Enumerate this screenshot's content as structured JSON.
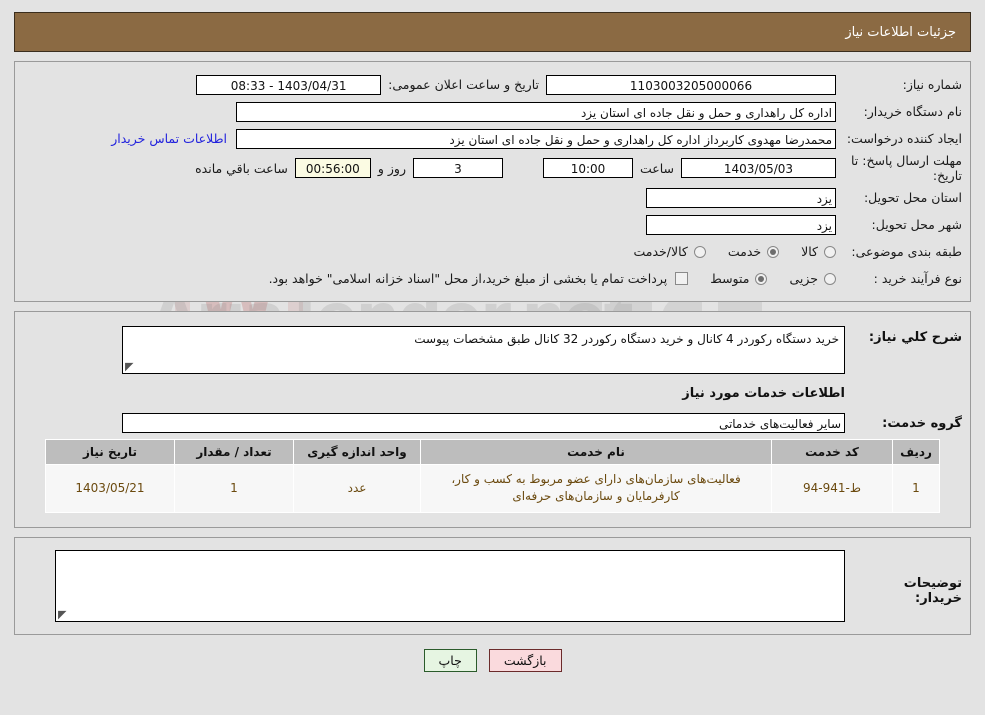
{
  "header": {
    "title": "جزئیات اطلاعات نیاز",
    "bg_color": "#8b6a43"
  },
  "watermark": {
    "text": "AriaTender.net"
  },
  "form": {
    "need_number": {
      "label": "شماره نیاز:",
      "value": "1103003205000066"
    },
    "announce_datetime": {
      "label": "تاریخ و ساعت اعلان عمومی:",
      "value": "1403/04/31 - 08:33"
    },
    "buyer_org": {
      "label": "نام دستگاه خریدار:",
      "value": "اداره کل راهداری و حمل و نقل جاده ای استان یزد"
    },
    "request_creator": {
      "label": "ایجاد کننده درخواست:",
      "value": "محمدرضا مهدوی کاربرداز اداره کل راهداری و حمل و نقل جاده ای استان یزد"
    },
    "contact_link": "اطلاعات تماس خریدار",
    "deadline": {
      "label": "مهلت ارسال پاسخ: تا تاریخ:",
      "date": "1403/05/03",
      "time_label": "ساعت",
      "time": "10:00",
      "days": "3",
      "days_label": "روز و",
      "remaining": "00:56:00",
      "remaining_label": "ساعت باقي مانده"
    },
    "delivery_province": {
      "label": "استان محل تحویل:",
      "value": "یزد"
    },
    "delivery_city": {
      "label": "شهر محل تحویل:",
      "value": "یزد"
    },
    "category": {
      "label": "طبقه بندی موضوعی:",
      "options": [
        "کالا",
        "خدمت",
        "کالا/خدمت"
      ],
      "selected": "خدمت"
    },
    "purchase_type": {
      "label": "نوع فرآیند خرید :",
      "options": [
        "جزیی",
        "متوسط"
      ],
      "selected": "متوسط"
    },
    "treasury_note": {
      "checked": false,
      "text": "پرداخت تمام یا بخشی از مبلغ خرید،از محل \"اسناد خزانه اسلامی\" خواهد بود."
    }
  },
  "description": {
    "label": "شرح كلي نياز:",
    "value": "خرید دستگاه رکوردر 4 کانال و خرید دستگاه رکوردر 32 کانال طبق مشخصات پیوست"
  },
  "services_section": {
    "title": "اطلاعات خدمات مورد نیاز",
    "service_group": {
      "label": "گروه خدمت:",
      "value": "سایر فعالیت‌های خدماتی"
    },
    "table": {
      "headers": [
        "ردیف",
        "کد خدمت",
        "نام خدمت",
        "واحد اندازه گیری",
        "تعداد / مقدار",
        "تاریخ نیاز"
      ],
      "rows": [
        {
          "row_no": "1",
          "service_code": "ط-941-94",
          "service_name": "فعالیت‌های سازمان‌های دارای عضو مربوط به کسب و کار، کارفرمایان و سازمان‌های حرفه‌ای",
          "unit": "عدد",
          "quantity": "1",
          "need_date": "1403/05/21"
        }
      ]
    }
  },
  "buyer_notes": {
    "label": "توضیحات خریدار:",
    "value": ""
  },
  "footer": {
    "back_button": "بازگشت",
    "print_button": "چاپ"
  }
}
